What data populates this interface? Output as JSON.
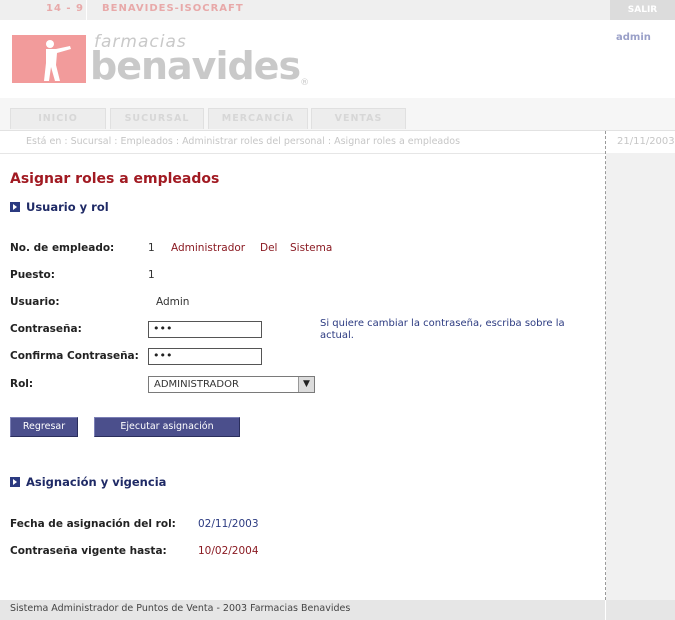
{
  "topbar": {
    "code": "14 - 9",
    "app_name": "BENAVIDES-ISOCRAFT",
    "logout_label": "SALIR"
  },
  "header": {
    "brand_line1": "farmacias",
    "brand_line2": "benavides",
    "brand_mark": "®",
    "user": "admin"
  },
  "tabs": [
    {
      "label": "INICIO"
    },
    {
      "label": "SUCURSAL"
    },
    {
      "label": "MERCANCÍA"
    },
    {
      "label": "VENTAS"
    }
  ],
  "breadcrumb": {
    "text": "Está en : Sucursal : Empleados : Administrar roles del personal : Asignar roles a empleados",
    "date": "21/11/2003"
  },
  "page": {
    "title": "Asignar roles a empleados",
    "section1": "Usuario y rol",
    "section2": "Asignación y vigencia"
  },
  "form": {
    "employee_no_label": "No. de empleado:",
    "employee_no": "1",
    "employee_first": "Administrador",
    "employee_middle": "Del",
    "employee_last": "Sistema",
    "position_label": "Puesto:",
    "position": "1",
    "user_label": "Usuario:",
    "user": "Admin",
    "password_label": "Contraseña:",
    "password_value": "•••",
    "confirm_label": "Confirma Contraseña:",
    "confirm_value": "•••",
    "password_hint": "Si quiere cambiar la contraseña, escriba sobre la actual.",
    "role_label": "Rol:",
    "role_selected": "ADMINISTRADOR"
  },
  "buttons": {
    "back": "Regresar",
    "execute": "Ejecutar asignación"
  },
  "assignment": {
    "date_label": "Fecha de asignación del rol:",
    "date": "02/11/2003",
    "valid_label": "Contraseña vigente hasta:",
    "valid_until": "10/02/2004"
  },
  "footer": {
    "text": "Sistema Administrador de Puntos de Venta - 2003 Farmacias Benavides"
  },
  "colors": {
    "brand_red": "#a11a22",
    "nav_blue": "#2b3a80",
    "button_bg": "#4b4f8c"
  }
}
